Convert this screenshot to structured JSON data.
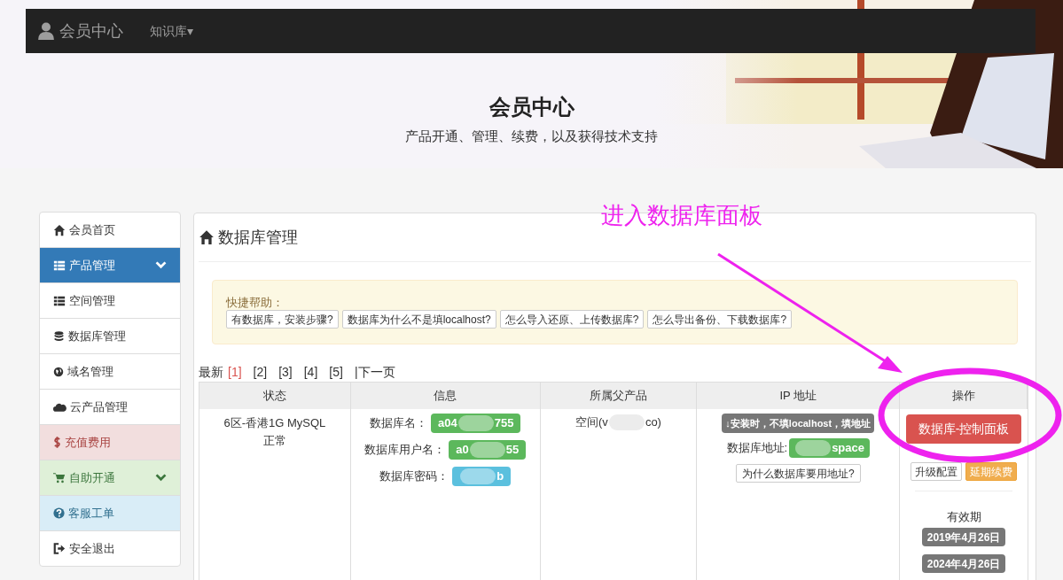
{
  "navbar": {
    "brand": "会员中心",
    "menu": {
      "label": "知识库",
      "caret": "▾"
    }
  },
  "banner": {
    "title": "会员中心",
    "subtitle": "产品开通、管理、续费，以及获得技术支持"
  },
  "sidebar": {
    "items": [
      {
        "label": "会员首页",
        "kind": "plain",
        "expanded": false
      },
      {
        "label": "产品管理",
        "kind": "primary",
        "expanded": true
      },
      {
        "label": "空间管理",
        "kind": "plain",
        "expanded": false
      },
      {
        "label": "数据库管理",
        "kind": "plain",
        "expanded": false
      },
      {
        "label": "域名管理",
        "kind": "plain",
        "expanded": false
      },
      {
        "label": "云产品管理",
        "kind": "plain",
        "expanded": false
      },
      {
        "label": "充值费用",
        "kind": "danger",
        "expanded": false
      },
      {
        "label": "自助开通",
        "kind": "success",
        "expanded": true
      },
      {
        "label": "客服工单",
        "kind": "info",
        "expanded": false
      },
      {
        "label": "安全退出",
        "kind": "plain",
        "expanded": false
      }
    ]
  },
  "panel": {
    "title": "数据库管理",
    "help": {
      "label": "快捷帮助：",
      "buttons": [
        "有数据库，安装步骤?",
        "数据库为什么不是填localhost?",
        "怎么导入还原、上传数据库?",
        "怎么导出备份、下载数据库?"
      ]
    },
    "pagination": {
      "label": "最新",
      "pages": [
        {
          "label": "[1]",
          "selected": true
        },
        {
          "label": "[2]",
          "selected": false
        },
        {
          "label": "[3]",
          "selected": false
        },
        {
          "label": "[4]",
          "selected": false
        },
        {
          "label": "[5]",
          "selected": false
        }
      ],
      "next": "|下一页"
    },
    "table": {
      "columns": [
        "状态",
        "信息",
        "所属父产品",
        "IP 地址",
        "操作"
      ],
      "rows": [
        {
          "status": [
            "6区-香港1G MySQL",
            "正常"
          ],
          "info": [
            {
              "label": "数据库名：",
              "start": "a04",
              "end": "755",
              "color": "#5cb85c"
            },
            {
              "label": "数据库用户名：",
              "start": "a0",
              "end": "55",
              "color": "#5cb85c"
            },
            {
              "label": "数据库密码：",
              "end": "b",
              "color": "#5bc0de"
            }
          ],
          "parent": {
            "start": "空间(v",
            "end": "co)"
          },
          "ip": {
            "note": "↓安装时，不填localhost，填地址",
            "label": "数据库地址:",
            "end": "space",
            "help": "为什么数据库要用地址?"
          },
          "actions": {
            "primary": "数据库-控制面板",
            "buttons": [
              {
                "label": "升级配置",
                "kind": "default"
              },
              {
                "label": "延期续费",
                "kind": "warning"
              }
            ],
            "validity_label": "有效期",
            "dates": [
              "2019年4月26日",
              "2024年4月26日"
            ]
          }
        }
      ]
    }
  },
  "annotation": {
    "text": "进入数据库面板",
    "color": "#ee22ee"
  }
}
